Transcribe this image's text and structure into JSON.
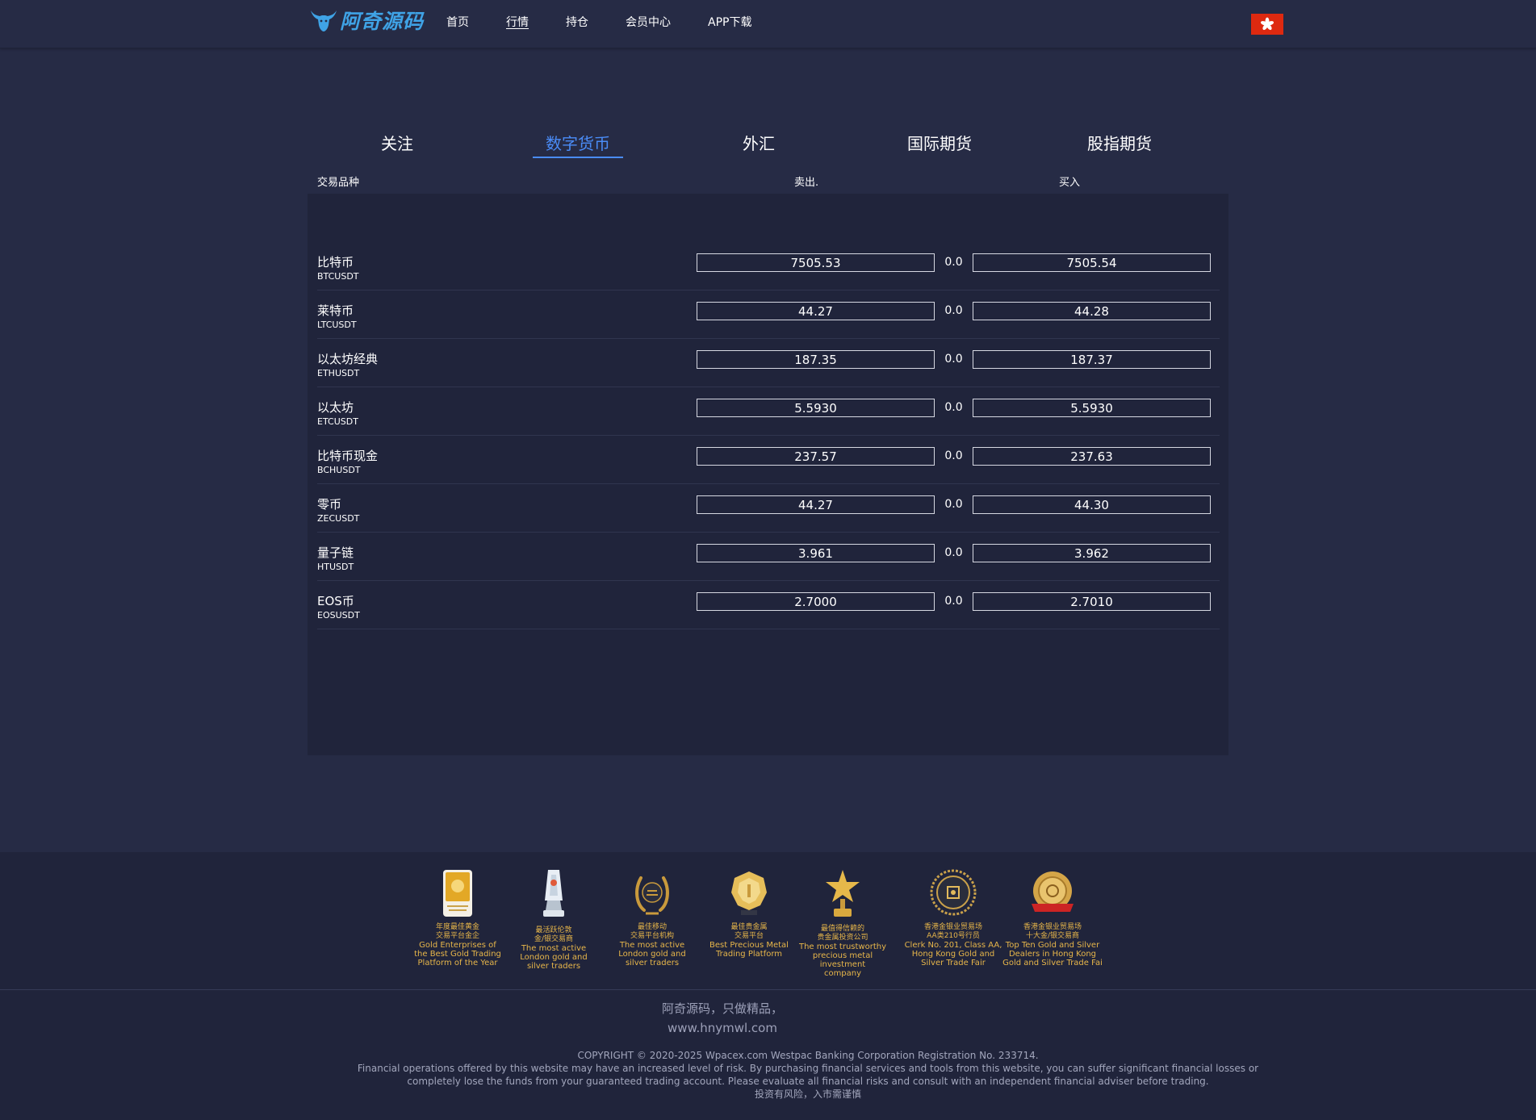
{
  "brand": {
    "name": "阿奇源码"
  },
  "nav": {
    "items": [
      "首页",
      "行情",
      "持仓",
      "会员中心",
      "APP下载"
    ],
    "active": "行情",
    "flag": "hong-kong-flag"
  },
  "tabs": {
    "items": [
      "关注",
      "数字货币",
      "外汇",
      "国际期货",
      "股指期货"
    ],
    "active": "数字货币"
  },
  "table": {
    "headers": {
      "product": "交易品种",
      "sell": "卖出.",
      "buy": "买入"
    },
    "rows": [
      {
        "name": "比特币",
        "code": "BTCUSDT",
        "sell": "7505.53",
        "change": "0.0",
        "buy": "7505.54"
      },
      {
        "name": "莱特币",
        "code": "LTCUSDT",
        "sell": "44.27",
        "change": "0.0",
        "buy": "44.28"
      },
      {
        "name": "以太坊经典",
        "code": "ETHUSDT",
        "sell": "187.35",
        "change": "0.0",
        "buy": "187.37"
      },
      {
        "name": "以太坊",
        "code": "ETCUSDT",
        "sell": "5.5930",
        "change": "0.0",
        "buy": "5.5930"
      },
      {
        "name": "比特币现金",
        "code": "BCHUSDT",
        "sell": "237.57",
        "change": "0.0",
        "buy": "237.63"
      },
      {
        "name": "零币",
        "code": "ZECUSDT",
        "sell": "44.27",
        "change": "0.0",
        "buy": "44.30"
      },
      {
        "name": "量子链",
        "code": "HTUSDT",
        "sell": "3.961",
        "change": "0.0",
        "buy": "3.962"
      },
      {
        "name": "EOS币",
        "code": "EOSUSDT",
        "sell": "2.7000",
        "change": "0.0",
        "buy": "2.7010"
      }
    ]
  },
  "awards": [
    {
      "cn1": "年度最佳黄金",
      "cn2": "交易平台金企",
      "en": [
        "Gold Enterprises of",
        "the Best Gold Trading",
        "Platform of the Year"
      ],
      "icon": "gold-plaque-icon"
    },
    {
      "cn1": "最活跃伦敦",
      "cn2": "金/银交易商",
      "en": [
        "The most active",
        "London gold and",
        "silver traders"
      ],
      "icon": "crystal-trophy-icon"
    },
    {
      "cn1": "最佳移动",
      "cn2": "交易平台机构",
      "en": [
        "The most active",
        "London gold and",
        "silver traders"
      ],
      "icon": "laurel-wreath-icon"
    },
    {
      "cn1": "最佳贵金属",
      "cn2": "交易平台",
      "en": [
        "Best Precious Metal",
        "Trading Platform"
      ],
      "icon": "gold-medal-icon"
    },
    {
      "cn1": "最值得信赖的",
      "cn2": "贵金属投资公司",
      "en": [
        "The most trustworthy",
        "precious metal investment",
        "company"
      ],
      "icon": "star-trophy-icon"
    },
    {
      "cn1": "香港金银业贸易场",
      "cn2": "AA类210号行员",
      "en": [
        "Clerk No. 201, Class AA,",
        "Hong Kong Gold and",
        "Silver Trade Fair"
      ],
      "icon": "seal-badge-icon"
    },
    {
      "cn1": "香港金银业贸易场",
      "cn2": "十大金/银交易商",
      "en": [
        "Top Ten Gold and Silver",
        "Dealers in Hong Kong",
        "Gold and Silver Trade Fai"
      ],
      "icon": "ribbon-medal-icon"
    }
  ],
  "footer": {
    "slogan1": "阿奇源码，只做精品，",
    "slogan2": "www.hnymwl.com",
    "copyright": "COPYRIGHT © 2020-2025 Wpacex.com Westpac Banking Corporation Registration No. 233714.",
    "disclaimer1": "Financial operations offered by this website may have an increased level of risk. By purchasing financial services and tools from this website, you can suffer significant financial losses or",
    "disclaimer2": "completely lose the funds from your guaranteed trading account. Please evaluate all financial risks and consult with an independent financial adviser before trading.",
    "risk": "投资有风险，入市需谨慎"
  },
  "colors": {
    "background": "#262b45",
    "panel": "#20243b",
    "accent": "#4a8cf7",
    "logo": "#3fa3e6",
    "gold": "#e7b64a",
    "flag": "#de2910"
  }
}
